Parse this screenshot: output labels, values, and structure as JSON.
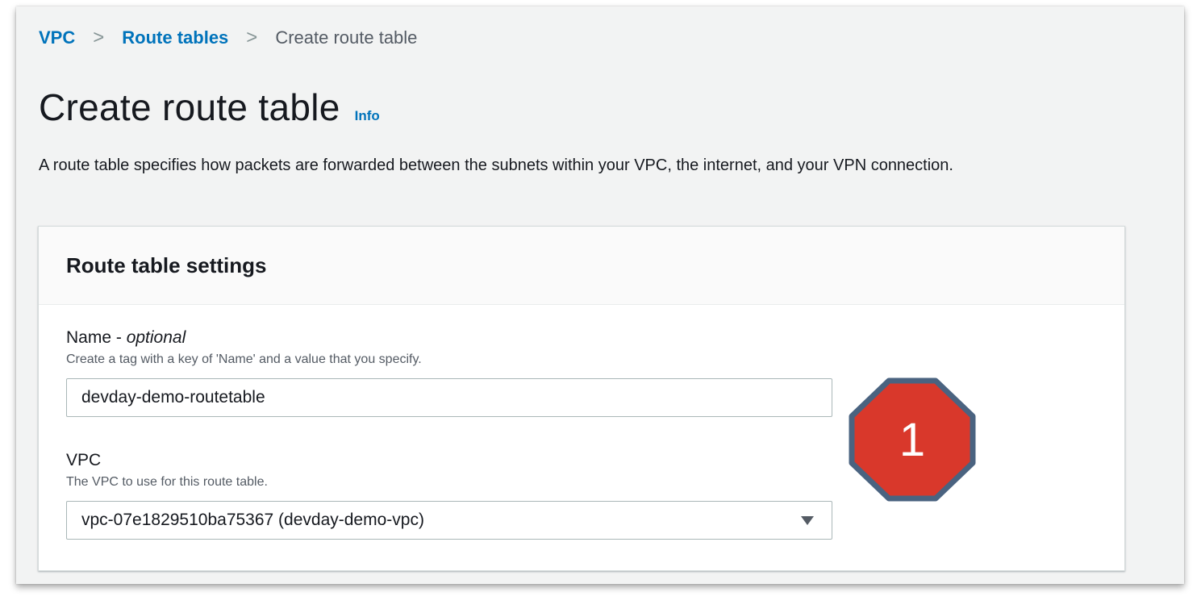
{
  "breadcrumb": {
    "items": [
      "VPC",
      "Route tables"
    ],
    "current": "Create route table",
    "separator": ">"
  },
  "page": {
    "title": "Create route table",
    "info_link": "Info",
    "description": "A route table specifies how packets are forwarded between the subnets within your VPC, the internet, and your VPN connection."
  },
  "settings": {
    "title": "Route table settings",
    "name_field": {
      "label": "Name -",
      "label_suffix": "optional",
      "description": "Create a tag with a key of 'Name' and a value that you specify.",
      "value": "devday-demo-routetable"
    },
    "vpc_field": {
      "label": "VPC",
      "description": "The VPC to use for this route table.",
      "selected": "vpc-07e1829510ba75367 (devday-demo-vpc)"
    }
  },
  "annotation": {
    "step_number": "1",
    "color": "#d9382b",
    "border_color": "#4a6380"
  },
  "colors": {
    "link": "#0073bb",
    "background": "#f2f3f3",
    "text": "#16191f"
  }
}
